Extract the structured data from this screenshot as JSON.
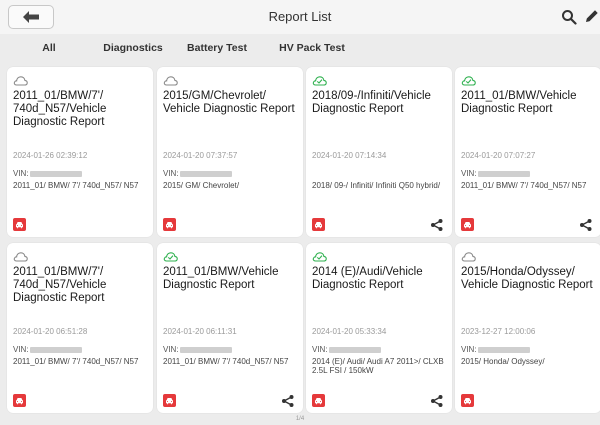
{
  "header": {
    "title": "Report List"
  },
  "tabs": [
    {
      "label": "All",
      "active": true
    },
    {
      "label": "Diagnostics",
      "active": false
    },
    {
      "label": "Battery Test",
      "active": false
    },
    {
      "label": "HV Pack Test",
      "active": false
    }
  ],
  "reports": [
    {
      "status": "cloud",
      "name": "2011_01/BMW/7'/ 740d_N57/Vehicle Diagnostic Report",
      "date": "2024-01-26 02:39:12",
      "vin_label": "VIN:",
      "path": "2011_01/ BMW/ 7'/ 740d_N57/ N57",
      "shareable": false
    },
    {
      "status": "cloud",
      "name": "2015/GM/Chevrolet/ Vehicle Diagnostic Report",
      "date": "2024-01-20 07:37:57",
      "vin_label": "VIN:",
      "path": "2015/ GM/ Chevrolet/",
      "shareable": false
    },
    {
      "status": "cloud-check",
      "name": "2018/09-/Infiniti/Vehicle Diagnostic Report",
      "date": "2024-01-20 07:14:34",
      "vin_label": "",
      "path": "2018/ 09-/ Infiniti/ Infiniti Q50 hybrid/",
      "shareable": true
    },
    {
      "status": "cloud-check",
      "name": "2011_01/BMW/Vehicle Diagnostic Report",
      "date": "2024-01-20 07:07:27",
      "vin_label": "VIN:",
      "path": "2011_01/ BMW/ 7'/ 740d_N57/ N57",
      "shareable": true
    },
    {
      "status": "cloud",
      "name": "2011_01/BMW/7'/ 740d_N57/Vehicle Diagnostic Report",
      "date": "2024-01-20 06:51:28",
      "vin_label": "VIN:",
      "path": "2011_01/ BMW/ 7'/ 740d_N57/ N57",
      "shareable": false
    },
    {
      "status": "cloud-check",
      "name": "2011_01/BMW/Vehicle Diagnostic Report",
      "date": "2024-01-20 06:11:31",
      "vin_label": "VIN:",
      "path": "2011_01/ BMW/ 7'/ 740d_N57/ N57",
      "shareable": true
    },
    {
      "status": "cloud-check",
      "name": "2014 (E)/Audi/Vehicle Diagnostic Report",
      "date": "2024-01-20 05:33:34",
      "vin_label": "VIN:",
      "path": "2014 (E)/ Audi/ Audi A7 2011>/ CLXB 2.5L FSI / 150kW",
      "shareable": true
    },
    {
      "status": "cloud",
      "name": "2015/Honda/Odyssey/ Vehicle Diagnostic Report",
      "date": "2023-12-27 12:00:06",
      "vin_label": "VIN:",
      "path": "2015/ Honda/ Odyssey/",
      "shareable": false
    }
  ],
  "pager": {
    "label": "1/4"
  },
  "colors": {
    "accent": "#1e7fe0",
    "check": "#2fb14f",
    "badge": "#e5393b"
  },
  "icons": {
    "back": "back-arrow-icon",
    "search": "search-icon",
    "edit": "edit-icon",
    "share": "share-icon",
    "car": "car-icon"
  }
}
